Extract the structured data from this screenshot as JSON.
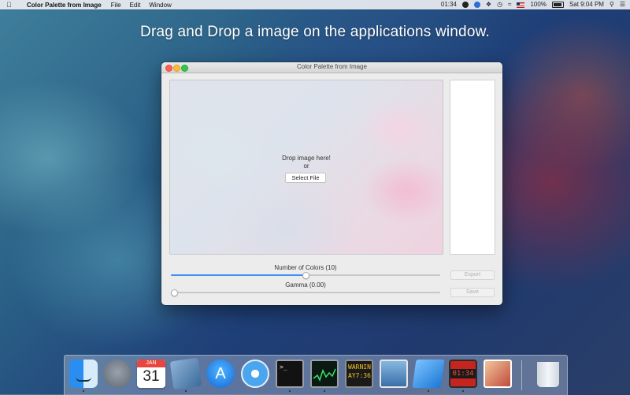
{
  "menubar": {
    "app_name": "Color Palette from Image",
    "menus": [
      "File",
      "Edit",
      "Window"
    ],
    "clock_status": "01:34",
    "battery": "100%",
    "datetime": "Sat 9:04 PM"
  },
  "headline": "Drag and Drop a image on the applications window.",
  "window": {
    "title": "Color Palette from Image",
    "drop_text": "Drop image here!",
    "or_text": "or",
    "select_file_label": "Select File",
    "colors_slider": {
      "label": "Number of Colors (10)",
      "value_fraction": 0.5
    },
    "gamma_slider": {
      "label": "Gamma (0.00)",
      "value_fraction": 0.0
    },
    "export_label": "Export",
    "save_label": "Save"
  },
  "dock": {
    "items": [
      {
        "name": "finder-icon"
      },
      {
        "name": "launchpad-icon"
      },
      {
        "name": "calendar-icon",
        "month": "JAN",
        "day": "31"
      },
      {
        "name": "preview-icon"
      },
      {
        "name": "app-store-icon"
      },
      {
        "name": "safari-icon"
      },
      {
        "name": "terminal-icon",
        "text": ">_"
      },
      {
        "name": "activity-monitor-icon"
      },
      {
        "name": "console-icon",
        "text": "WARNIN AY7:36"
      },
      {
        "name": "image-viewer-icon"
      },
      {
        "name": "xcode-icon"
      },
      {
        "name": "clock-icon",
        "text": "01:34"
      },
      {
        "name": "photos-icon"
      },
      {
        "name": "trash-icon"
      }
    ]
  },
  "colors": {
    "accent": "#3f8ff0",
    "close": "#fc5f57",
    "minimize": "#fdbc2e",
    "zoom": "#33c748"
  }
}
